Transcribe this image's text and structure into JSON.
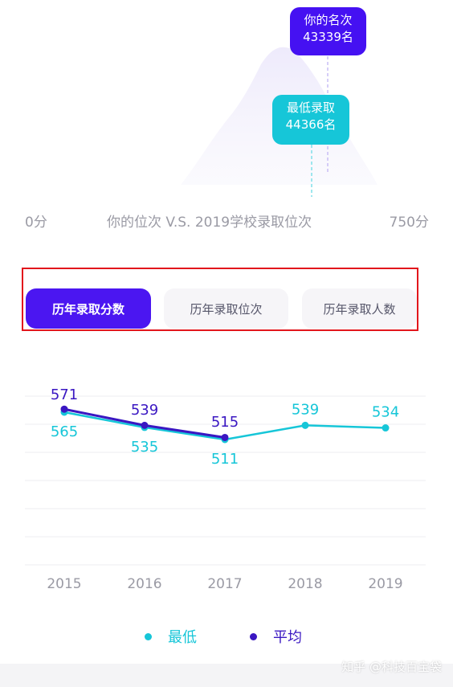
{
  "colors": {
    "primary": "#4b16f1",
    "accent": "#16c6d8",
    "avg_series": "#3a17c2",
    "highlight_border": "#e2161c"
  },
  "distribution": {
    "your_rank_label": "你的名次",
    "your_rank_value": "43339名",
    "min_rank_label": "最低录取",
    "min_rank_value": "44366名",
    "axis_left": "0分",
    "axis_center": "你的位次 V.S. 2019学校录取位次",
    "axis_right": "750分"
  },
  "tabs": [
    {
      "label": "历年录取分数",
      "active": true
    },
    {
      "label": "历年录取位次",
      "active": false
    },
    {
      "label": "历年录取人数",
      "active": false
    }
  ],
  "chart_data": {
    "type": "line",
    "x": [
      "2015",
      "2016",
      "2017",
      "2018",
      "2019"
    ],
    "series": [
      {
        "name": "最低",
        "color": "#16c6d8",
        "values": [
          565,
          535,
          511,
          539,
          534
        ]
      },
      {
        "name": "平均",
        "color": "#3a17c2",
        "values": [
          571,
          539,
          515,
          null,
          null
        ]
      }
    ],
    "legend_position": "bottom",
    "grid": true
  },
  "legend": {
    "min_label": "最低",
    "avg_label": "平均"
  },
  "watermark": "知乎 @科技百宝袋"
}
